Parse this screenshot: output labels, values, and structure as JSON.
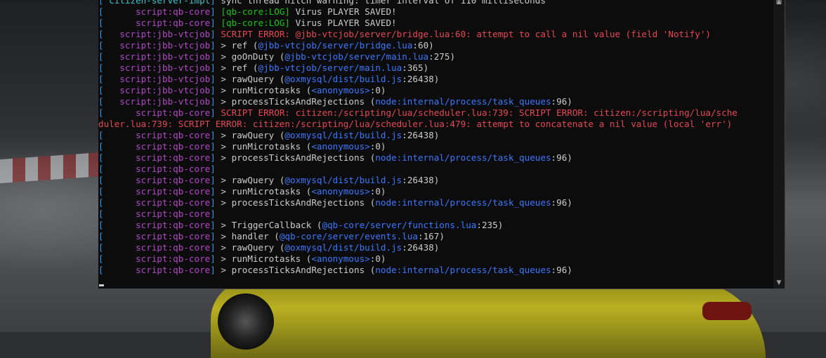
{
  "console": {
    "lines": [
      {
        "prefix": "[ citizen-server-impl]",
        "prefix_color": "cyan",
        "segments": [
          {
            "t": " sync thread hitch warning: timer interval of 110 milliseconds",
            "c": "wht"
          }
        ]
      },
      {
        "prefix": "[      script:qb-core]",
        "prefix_color": "res",
        "segments": [
          {
            "t": " [qb-core:LOG]",
            "c": "green"
          },
          {
            "t": " Virus PLAYER SAVED!",
            "c": "wht"
          }
        ]
      },
      {
        "prefix": "[      script:qb-core]",
        "prefix_color": "res",
        "segments": [
          {
            "t": " [qb-core:LOG]",
            "c": "green"
          },
          {
            "t": " Virus PLAYER SAVED!",
            "c": "wht"
          }
        ]
      },
      {
        "prefix": "[   script:jbb-vtcjob]",
        "prefix_color": "res",
        "segments": [
          {
            "t": " SCRIPT ERROR: @jbb-vtcjob/server/bridge.lua:60: attempt to call a nil value (field 'Notify')",
            "c": "red"
          }
        ]
      },
      {
        "prefix": "[   script:jbb-vtcjob]",
        "prefix_color": "res",
        "segments": [
          {
            "t": " > ref (",
            "c": "wht"
          },
          {
            "t": "@jbb-vtcjob/server/bridge.lua",
            "c": "blue"
          },
          {
            "t": ":60)",
            "c": "wht"
          }
        ]
      },
      {
        "prefix": "[   script:jbb-vtcjob]",
        "prefix_color": "res",
        "segments": [
          {
            "t": " > goOnDuty (",
            "c": "wht"
          },
          {
            "t": "@jbb-vtcjob/server/main.lua",
            "c": "blue"
          },
          {
            "t": ":275)",
            "c": "wht"
          }
        ]
      },
      {
        "prefix": "[   script:jbb-vtcjob]",
        "prefix_color": "res",
        "segments": [
          {
            "t": " > ref (",
            "c": "wht"
          },
          {
            "t": "@jbb-vtcjob/server/main.lua",
            "c": "blue"
          },
          {
            "t": ":365)",
            "c": "wht"
          }
        ]
      },
      {
        "prefix": "[   script:jbb-vtcjob]",
        "prefix_color": "res",
        "segments": [
          {
            "t": " > rawQuery (",
            "c": "wht"
          },
          {
            "t": "@oxmysql/dist/build.js",
            "c": "blue"
          },
          {
            "t": ":26438)",
            "c": "wht"
          }
        ]
      },
      {
        "prefix": "[   script:jbb-vtcjob]",
        "prefix_color": "res",
        "segments": [
          {
            "t": " > runMicrotasks (",
            "c": "wht"
          },
          {
            "t": "<anonymous>",
            "c": "blue"
          },
          {
            "t": ":0)",
            "c": "wht"
          }
        ]
      },
      {
        "prefix": "[   script:jbb-vtcjob]",
        "prefix_color": "res",
        "segments": [
          {
            "t": " > processTicksAndRejections (",
            "c": "wht"
          },
          {
            "t": "node:internal/process/task_queues",
            "c": "blue"
          },
          {
            "t": ":96)",
            "c": "wht"
          }
        ]
      },
      {
        "prefix": "[      script:qb-core]",
        "prefix_color": "res",
        "segments": [
          {
            "t": " SCRIPT ERROR: citizen:/scripting/lua/scheduler.lua:739: SCRIPT ERROR: citizen:/scripting/lua/sche",
            "c": "red"
          }
        ]
      },
      {
        "prefix": "",
        "prefix_color": "res",
        "segments": [
          {
            "t": "duler.lua:739: SCRIPT ERROR: citizen:/scripting/lua/scheduler.lua:479: attempt to concatenate a nil value (local 'err')",
            "c": "red"
          }
        ]
      },
      {
        "prefix": "[      script:qb-core]",
        "prefix_color": "res",
        "segments": [
          {
            "t": " > rawQuery (",
            "c": "wht"
          },
          {
            "t": "@oxmysql/dist/build.js",
            "c": "blue"
          },
          {
            "t": ":26438)",
            "c": "wht"
          }
        ]
      },
      {
        "prefix": "[      script:qb-core]",
        "prefix_color": "res",
        "segments": [
          {
            "t": " > runMicrotasks (",
            "c": "wht"
          },
          {
            "t": "<anonymous>",
            "c": "blue"
          },
          {
            "t": ":0)",
            "c": "wht"
          }
        ]
      },
      {
        "prefix": "[      script:qb-core]",
        "prefix_color": "res",
        "segments": [
          {
            "t": " > processTicksAndRejections (",
            "c": "wht"
          },
          {
            "t": "node:internal/process/task_queues",
            "c": "blue"
          },
          {
            "t": ":96)",
            "c": "wht"
          }
        ]
      },
      {
        "prefix": "[      script:qb-core]",
        "prefix_color": "res",
        "segments": []
      },
      {
        "prefix": "[      script:qb-core]",
        "prefix_color": "res",
        "segments": [
          {
            "t": " > rawQuery (",
            "c": "wht"
          },
          {
            "t": "@oxmysql/dist/build.js",
            "c": "blue"
          },
          {
            "t": ":26438)",
            "c": "wht"
          }
        ]
      },
      {
        "prefix": "[      script:qb-core]",
        "prefix_color": "res",
        "segments": [
          {
            "t": " > runMicrotasks (",
            "c": "wht"
          },
          {
            "t": "<anonymous>",
            "c": "blue"
          },
          {
            "t": ":0)",
            "c": "wht"
          }
        ]
      },
      {
        "prefix": "[      script:qb-core]",
        "prefix_color": "res",
        "segments": [
          {
            "t": " > processTicksAndRejections (",
            "c": "wht"
          },
          {
            "t": "node:internal/process/task_queues",
            "c": "blue"
          },
          {
            "t": ":96)",
            "c": "wht"
          }
        ]
      },
      {
        "prefix": "[      script:qb-core]",
        "prefix_color": "res",
        "segments": []
      },
      {
        "prefix": "[      script:qb-core]",
        "prefix_color": "res",
        "segments": [
          {
            "t": " > TriggerCallback (",
            "c": "wht"
          },
          {
            "t": "@qb-core/server/functions.lua",
            "c": "blue"
          },
          {
            "t": ":235)",
            "c": "wht"
          }
        ]
      },
      {
        "prefix": "[      script:qb-core]",
        "prefix_color": "res",
        "segments": [
          {
            "t": " > handler (",
            "c": "wht"
          },
          {
            "t": "@qb-core/server/events.lua",
            "c": "blue"
          },
          {
            "t": ":167)",
            "c": "wht"
          }
        ]
      },
      {
        "prefix": "[      script:qb-core]",
        "prefix_color": "res",
        "segments": [
          {
            "t": " > rawQuery (",
            "c": "wht"
          },
          {
            "t": "@oxmysql/dist/build.js",
            "c": "blue"
          },
          {
            "t": ":26438)",
            "c": "wht"
          }
        ]
      },
      {
        "prefix": "[      script:qb-core]",
        "prefix_color": "res",
        "segments": [
          {
            "t": " > runMicrotasks (",
            "c": "wht"
          },
          {
            "t": "<anonymous>",
            "c": "blue"
          },
          {
            "t": ":0)",
            "c": "wht"
          }
        ]
      },
      {
        "prefix": "[      script:qb-core]",
        "prefix_color": "res",
        "segments": [
          {
            "t": " > processTicksAndRejections (",
            "c": "wht"
          },
          {
            "t": "node:internal/process/task_queues",
            "c": "blue"
          },
          {
            "t": ":96)",
            "c": "wht"
          }
        ]
      }
    ]
  },
  "colors": {
    "console_bg": "#0c0c0c",
    "bracket": "#3a96dd",
    "resource": "#b148c6",
    "error": "#e74856",
    "path": "#3b78ff",
    "log_tag": "#16c60c",
    "server_impl": "#3ac5c9",
    "text": "#cccccc"
  },
  "icons": {
    "scroll_up": "scroll-up-arrow-icon",
    "scroll_down": "scroll-down-arrow-icon"
  }
}
